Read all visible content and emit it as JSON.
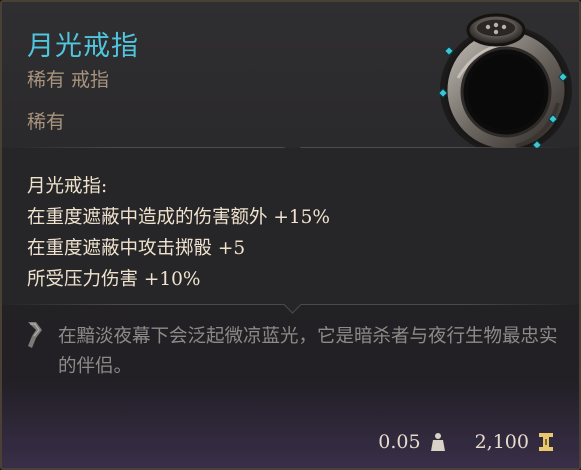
{
  "item": {
    "name": "月光戒指",
    "subtitle": "稀有 戒指",
    "rarity": "稀有",
    "icon": "moonlight-ring-art"
  },
  "properties": {
    "title": "月光戒指:",
    "lines": [
      "在重度遮蔽中造成的伤害额外 +15%",
      "在重度遮蔽中攻击掷骰 +5",
      "所受压力伤害 +10%"
    ]
  },
  "lore": {
    "text": "在黯淡夜幕下会泛起微凉蓝光，它是暗杀者与夜行生物最忠实的伴侣。",
    "icon": "quote-icon"
  },
  "footer": {
    "weight": "0.05",
    "weight_icon": "weight-icon",
    "price": "2,100",
    "price_icon": "gold-icon"
  },
  "colors": {
    "name": "#4fc6dd",
    "subtitle": "#a8947e",
    "properties": "#efe2cf",
    "lore": "#8f8a88",
    "gem": "#3ec5d6"
  }
}
